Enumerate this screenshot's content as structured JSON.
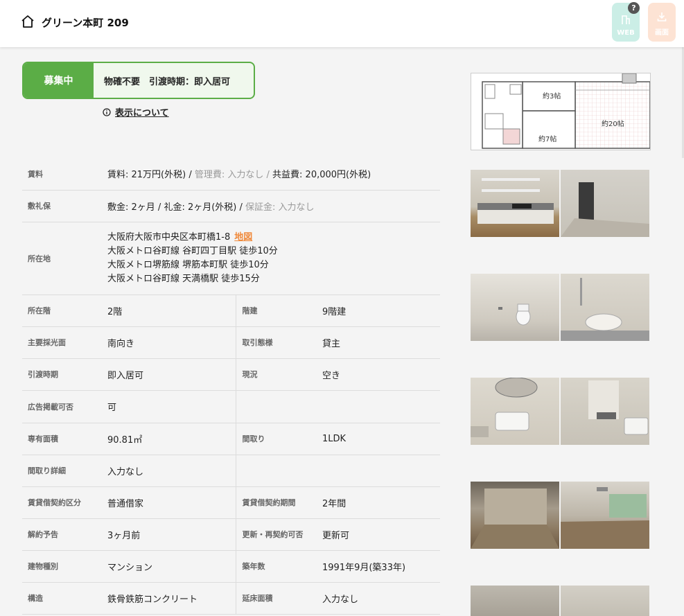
{
  "header": {
    "title": "グリーン本町 209",
    "web_label": "WEB",
    "dl_label": "画面",
    "help": "?",
    "home_icon": "home-icon",
    "download_icon": "download-icon",
    "colors": {
      "web_bg": "#cbeee6",
      "dl_bg": "#fde3d4"
    }
  },
  "status": {
    "badge": "募集中",
    "info": "物確不要　引渡時期：即入居可",
    "color": "#5bad46"
  },
  "display_note": "表示について",
  "specs": {
    "rent": {
      "label": "賃料",
      "rent": "賃料: 21万円(外税)",
      "sep1": " / ",
      "mgmt": "管理費: 入力なし",
      "sep2": " / ",
      "common": "共益費: 20,000円(外税)"
    },
    "deposit": {
      "label": "敷礼保",
      "shiki": "敷金: 2ヶ月",
      "sep1": " / ",
      "rei": "礼金: 2ヶ月(外税)",
      "sep2": " / ",
      "hosho": "保証金: 入力なし"
    },
    "location": {
      "label": "所在地",
      "address": "大阪府大阪市中央区本町橋1-8",
      "map": "地図",
      "stations": [
        "大阪メトロ谷町線 谷町四丁目駅 徒歩10分",
        "大阪メトロ堺筋線 堺筋本町駅 徒歩10分",
        "大阪メトロ谷町線 天満橋駅 徒歩15分"
      ]
    },
    "rows": [
      {
        "l1": "所在階",
        "v1": "2階",
        "l2": "階建",
        "v2": "9階建"
      },
      {
        "l1": "主要採光面",
        "v1": "南向き",
        "l2": "取引態様",
        "v2": "貸主"
      },
      {
        "l1": "引渡時期",
        "v1": "即入居可",
        "l2": "現況",
        "v2": "空き"
      },
      {
        "l1": "広告掲載可否",
        "v1": "可",
        "l2": "",
        "v2": ""
      },
      {
        "l1": "専有面積",
        "v1": "90.81㎡",
        "l2": "間取り",
        "v2": "1LDK"
      },
      {
        "l1": "間取り詳細",
        "v1": "入力なし",
        "l2": "",
        "v2": ""
      },
      {
        "l1": "賃貸借契約区分",
        "v1": "普通借家",
        "l2": "賃貸借契約期間",
        "v2": "2年間"
      },
      {
        "l1": "解約予告",
        "v1": "3ヶ月前",
        "l2": "更新・再契約可否",
        "v2": "更新可"
      },
      {
        "l1": "建物種別",
        "v1": "マンション",
        "l2": "築年数",
        "v2": "1991年9月(築33年)"
      },
      {
        "l1": "構造",
        "v1": "鉄骨鉄筋コンクリート",
        "l2": "延床面積",
        "v2": "入力なし"
      }
    ]
  },
  "floorplan": {
    "room1": "約3帖",
    "room2": "約20帖",
    "room3": "約7帖"
  }
}
